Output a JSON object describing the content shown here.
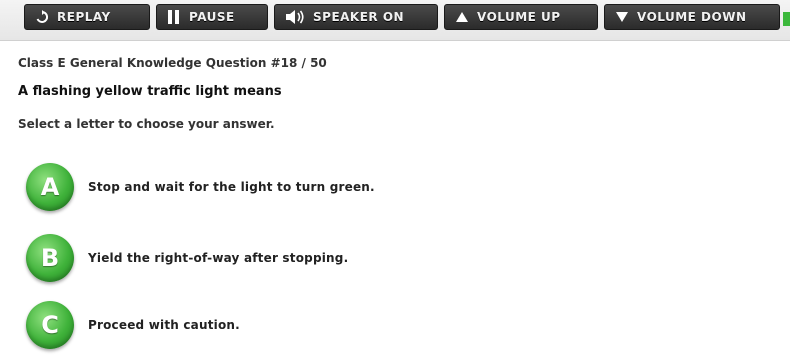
{
  "toolbar": {
    "replay_label": "REPLAY",
    "pause_label": "PAUSE",
    "speaker_label": "SPEAKER ON",
    "volume_up_label": "VOLUME UP",
    "volume_down_label": "VOLUME DOWN"
  },
  "question": {
    "header": "Class E General Knowledge Question #18 / 50",
    "text": "A flashing yellow traffic light means",
    "instruction": "Select a letter to choose your answer."
  },
  "answers": [
    {
      "letter": "A",
      "text": "Stop and wait for the light to turn green."
    },
    {
      "letter": "B",
      "text": "Yield the right-of-way after stopping."
    },
    {
      "letter": "C",
      "text": "Proceed with caution."
    }
  ],
  "colors": {
    "answer_badge": "#3fb23a",
    "toolbar_button": "#2b2b2b"
  },
  "icons": [
    "replay-icon",
    "pause-icon",
    "speaker-icon",
    "volume-up-icon",
    "volume-down-icon"
  ]
}
